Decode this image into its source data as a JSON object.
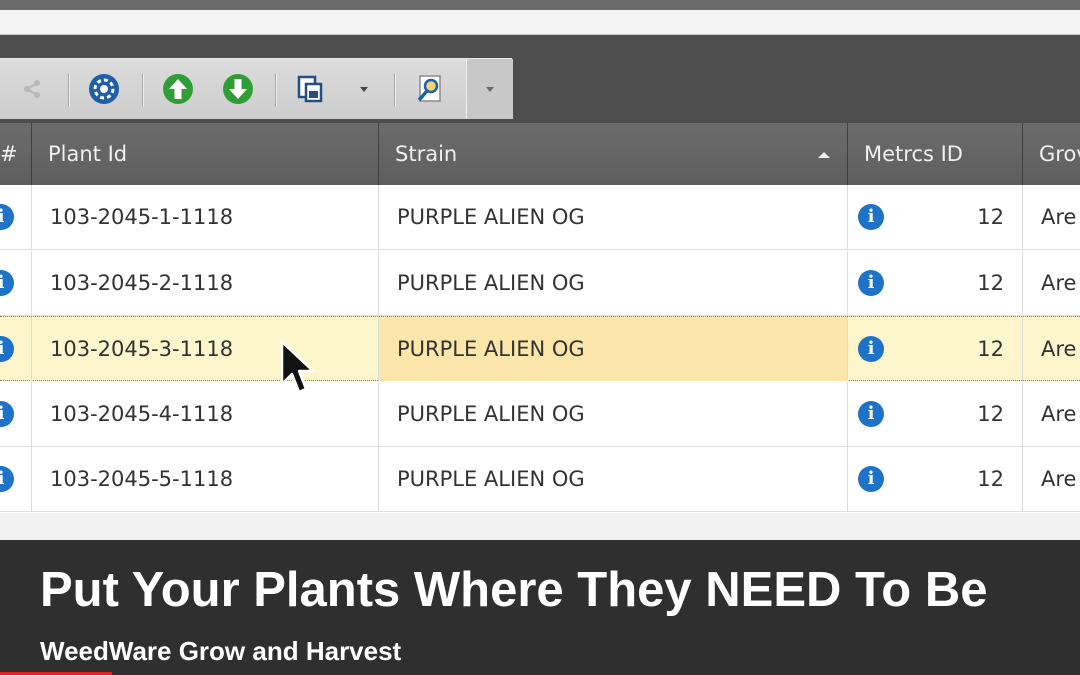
{
  "toolbar": {
    "icons": [
      "share-icon",
      "settings-gear-icon",
      "move-up-icon",
      "move-down-icon",
      "copy-icon",
      "dropdown-arrow-icon",
      "search-report-icon",
      "more-dropdown-icon"
    ]
  },
  "grid": {
    "columns": [
      {
        "label": "#"
      },
      {
        "label": "Plant Id"
      },
      {
        "label": "Strain",
        "sort": "ascending"
      },
      {
        "label": "Metrcs ID"
      },
      {
        "label": "Grov"
      }
    ],
    "rows": [
      {
        "plant_id": "103-2045-1-1118",
        "strain": "PURPLE ALIEN OG",
        "metrcs": "12",
        "grow": "Are",
        "selected": false
      },
      {
        "plant_id": "103-2045-2-1118",
        "strain": "PURPLE ALIEN OG",
        "metrcs": "12",
        "grow": "Are",
        "selected": false
      },
      {
        "plant_id": "103-2045-3-1118",
        "strain": "PURPLE ALIEN OG",
        "metrcs": "12",
        "grow": "Are",
        "selected": true
      },
      {
        "plant_id": "103-2045-4-1118",
        "strain": "PURPLE ALIEN OG",
        "metrcs": "12",
        "grow": "Are",
        "selected": false
      },
      {
        "plant_id": "103-2045-5-1118",
        "strain": "PURPLE ALIEN OG",
        "metrcs": "12",
        "grow": "Are",
        "selected": false
      }
    ]
  },
  "banner": {
    "title": "Put Your Plants Where They NEED To Be",
    "subtitle": "WeedWare Grow and Harvest"
  },
  "colors": {
    "selected_row": "#fdf5cc",
    "info_icon": "#1e73c8",
    "header": "#5e5e5e",
    "progress_red": "#e3222a"
  }
}
